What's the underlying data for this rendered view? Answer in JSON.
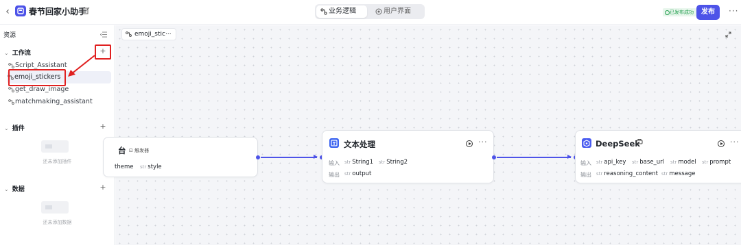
{
  "header": {
    "app_title": "春节回家小助手",
    "tabs": [
      {
        "label": "业务逻辑",
        "active": true
      },
      {
        "label": "用户界面",
        "active": false
      }
    ],
    "status_badge": "已发布成功",
    "publish_label": "发布",
    "more": "···"
  },
  "sidebar": {
    "title": "资源",
    "sections": {
      "workflow": {
        "label": "工作流",
        "items": [
          "Script_Assistant",
          "emoji_stickers",
          "get_draw_image",
          "matchmaking_assistant"
        ],
        "selected": "emoji_stickers"
      },
      "plugins": {
        "label": "插件",
        "empty_text": "还未添加插件"
      },
      "data": {
        "label": "数据",
        "empty_text": "还未添加数据"
      }
    }
  },
  "canvas": {
    "tab_label": "emoji_stic···",
    "nodes": {
      "start": {
        "title": "台",
        "tag": "触发器",
        "inputs": [
          {
            "type": "str",
            "name": "style"
          }
        ],
        "partial_text": "theme"
      },
      "text_process": {
        "title": "文本处理",
        "input_label": "输入",
        "output_label": "输出",
        "inputs": [
          {
            "type": "str",
            "name": "String1"
          },
          {
            "type": "str",
            "name": "String2"
          }
        ],
        "outputs": [
          {
            "type": "str",
            "name": "output"
          }
        ],
        "more": "···"
      },
      "deepseek": {
        "title": "DeepSeek",
        "input_label": "输入",
        "output_label": "输出",
        "inputs": [
          {
            "type": "str",
            "name": "api_key"
          },
          {
            "type": "str",
            "name": "base_url"
          },
          {
            "type": "str",
            "name": "model"
          },
          {
            "type": "str",
            "name": "prompt"
          }
        ],
        "outputs": [
          {
            "type": "str",
            "name": "reasoning_content"
          },
          {
            "type": "str",
            "name": "message"
          }
        ],
        "more": "···"
      }
    }
  },
  "colors": {
    "accent": "#4d53e8",
    "annotation": "#e02020",
    "success": "#1e9c4b"
  }
}
